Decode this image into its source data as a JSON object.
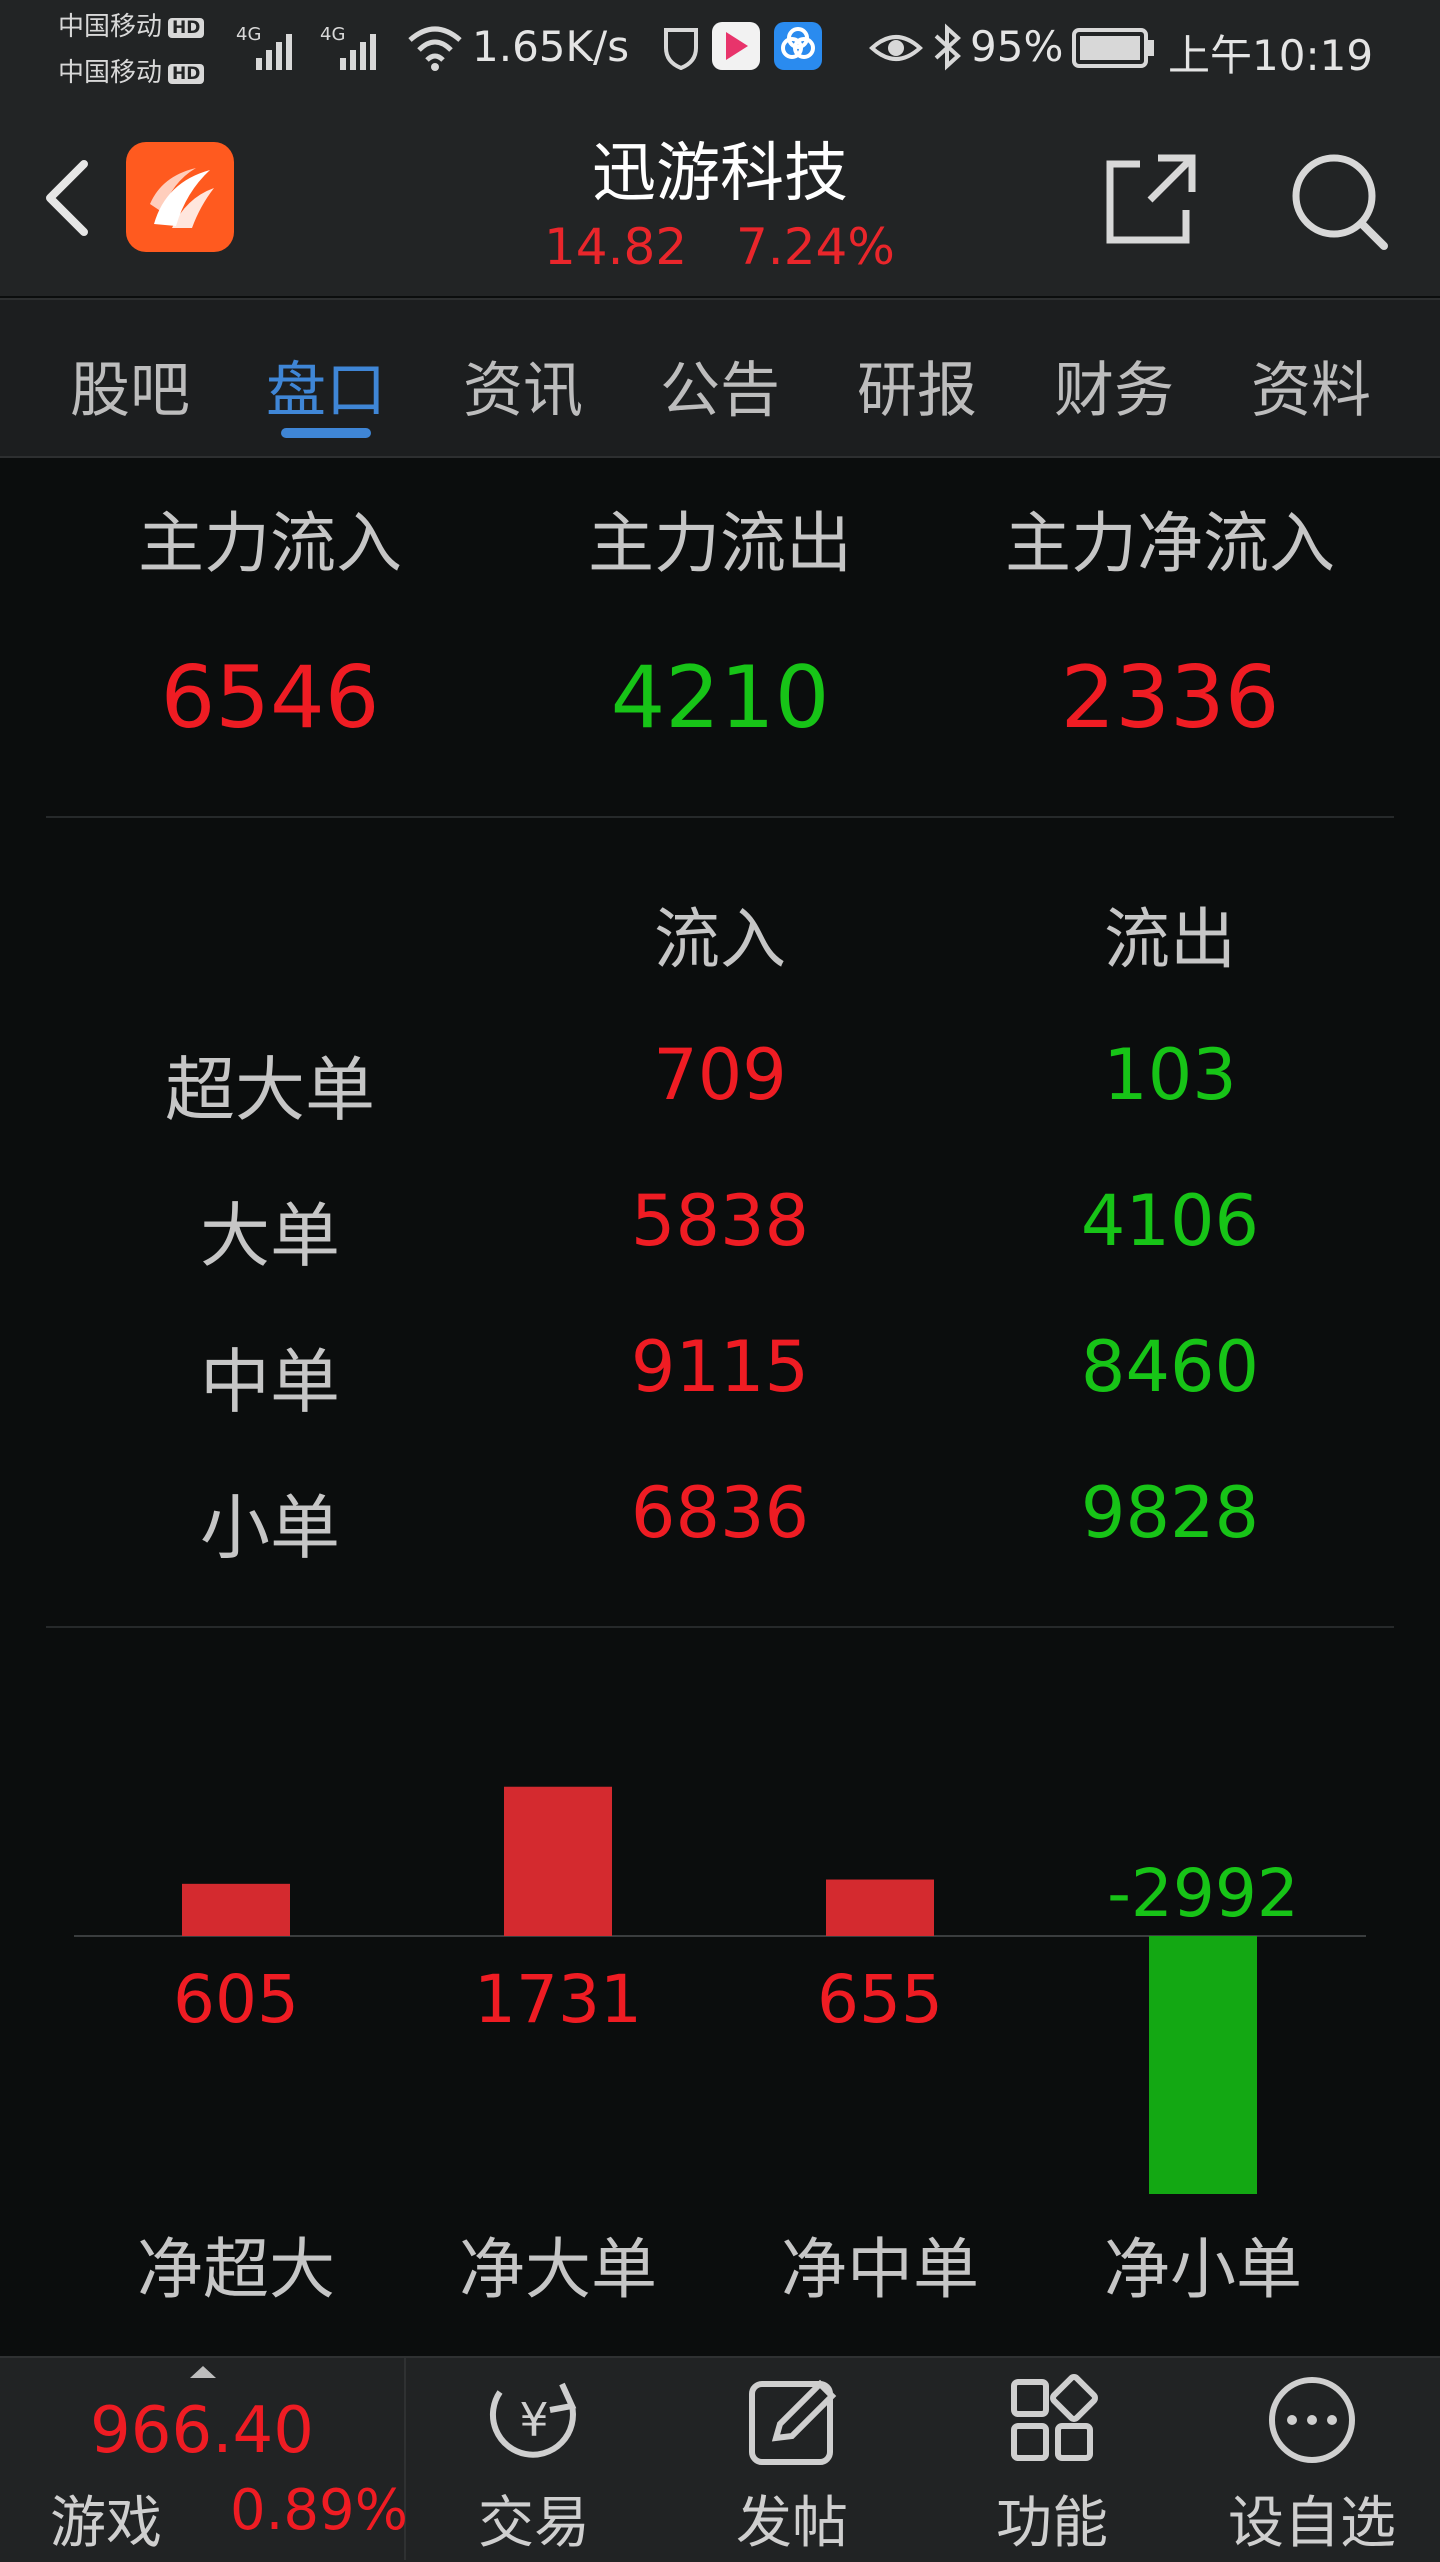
{
  "status_bar": {
    "carrier1": "中国移动",
    "carrier2": "中国移动",
    "hd": "HD",
    "network": "4G",
    "speed": "1.65K/s",
    "battery": "95%",
    "time": "上午10:19"
  },
  "header": {
    "title": "迅游科技",
    "price": "14.82",
    "change_pct": "7.24%"
  },
  "tabs": [
    "股吧",
    "盘口",
    "资讯",
    "公告",
    "研报",
    "财务",
    "资料"
  ],
  "active_tab_index": 1,
  "summary": {
    "labels": [
      "主力流入",
      "主力流出",
      "主力净流入"
    ],
    "values": [
      "6546",
      "4210",
      "2336"
    ]
  },
  "flow_table": {
    "headers": [
      "流入",
      "流出"
    ],
    "rows": [
      {
        "label": "超大单",
        "inflow": "709",
        "outflow": "103"
      },
      {
        "label": "大单",
        "inflow": "5838",
        "outflow": "4106"
      },
      {
        "label": "中单",
        "inflow": "9115",
        "outflow": "8460"
      },
      {
        "label": "小单",
        "inflow": "6836",
        "outflow": "9828"
      }
    ]
  },
  "chart_data": {
    "type": "bar",
    "categories": [
      "净超大",
      "净大单",
      "净中单",
      "净小单"
    ],
    "values": [
      605,
      1731,
      655,
      -2992
    ],
    "value_labels": [
      "605",
      "1731",
      "655",
      "-2992"
    ],
    "colors": {
      "positive": "#d42a2f",
      "negative": "#13a813",
      "positive_text": "#ef1c23",
      "negative_text": "#17c417"
    }
  },
  "bottom_bar": {
    "index_value": "966.40",
    "index_name": "游戏",
    "index_change": "0.89%",
    "items": [
      {
        "label": "交易",
        "icon": "trade-yen-icon"
      },
      {
        "label": "发帖",
        "icon": "compose-icon"
      },
      {
        "label": "功能",
        "icon": "grid-icon"
      },
      {
        "label": "设自选",
        "icon": "more-dots-icon"
      }
    ]
  },
  "colors": {
    "up": "#ef1c23",
    "down": "#17c417",
    "accent": "#3f86d6",
    "app_icon": "#ff5a1f"
  }
}
